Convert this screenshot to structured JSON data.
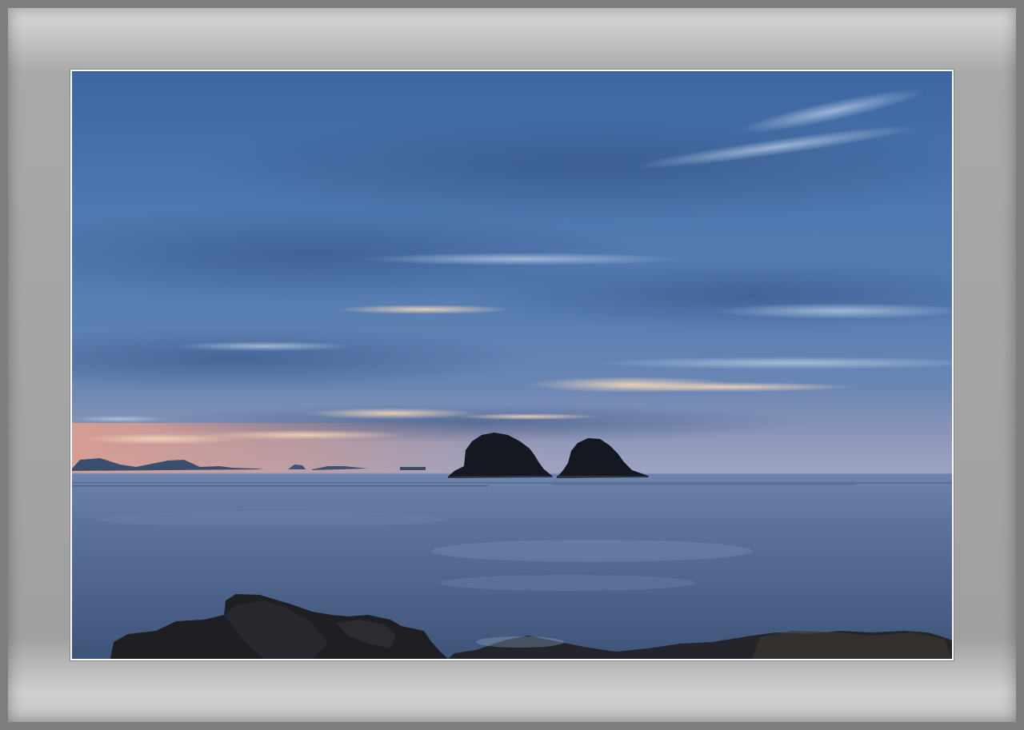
{
  "image": {
    "subject": "dusk-seascape",
    "colors": {
      "frame": "#a6a6a6",
      "sky_top": "#3f6aa3",
      "sky_mid": "#5a82b8",
      "horizon_glow": "#e0a08a",
      "sea": "#51698f",
      "rocks": "#1e2024"
    }
  }
}
